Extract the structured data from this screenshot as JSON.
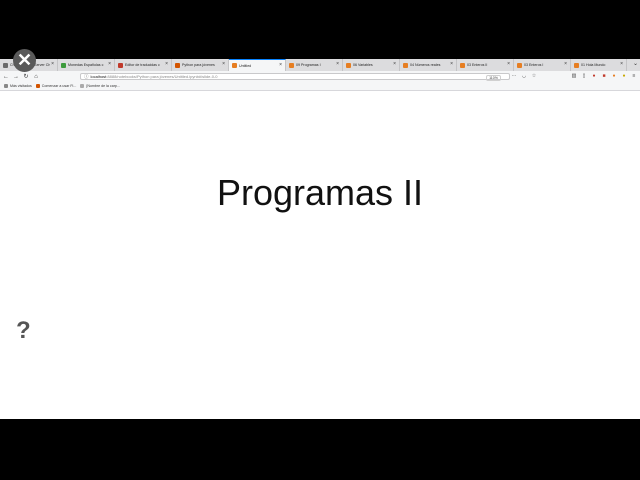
{
  "tabs": [
    {
      "title": "Chess Results Server Chi",
      "color": "#6a6a6a",
      "active": false
    },
    {
      "title": "Monedas Españolas c",
      "color": "#3c9a3c",
      "active": false
    },
    {
      "title": "Editor de traducidas c",
      "color": "#c0392b",
      "active": false
    },
    {
      "title": "Python para jóvenes",
      "color": "#d35400",
      "active": false
    },
    {
      "title": "Untitled",
      "color": "#e67e22",
      "active": true
    },
    {
      "title": "09 Programas I",
      "color": "#e67e22",
      "active": false
    },
    {
      "title": "06 Variables",
      "color": "#e67e22",
      "active": false
    },
    {
      "title": "04 Números reales",
      "color": "#e67e22",
      "active": false
    },
    {
      "title": "03 Enteros II",
      "color": "#e67e22",
      "active": false
    },
    {
      "title": "03 Enteros I",
      "color": "#e67e22",
      "active": false
    },
    {
      "title": "01 Hola Mundo",
      "color": "#e67e22",
      "active": false
    }
  ],
  "url": {
    "host": "localhost",
    "path": ":8888/notebooks/Python para jóvenes/Untitled.ipynb#/slide-0-0"
  },
  "zoom": "110%",
  "bookmarks": [
    {
      "label": "Más visitados",
      "color": "#888"
    },
    {
      "label": "Comenzar a usar Fi...",
      "color": "#d35400"
    },
    {
      "label": "[Nombre de la carp...",
      "color": "#aaa"
    }
  ],
  "slide": {
    "title": "Programas II"
  },
  "icons": {
    "close": "close-icon",
    "help": "help-icon"
  }
}
